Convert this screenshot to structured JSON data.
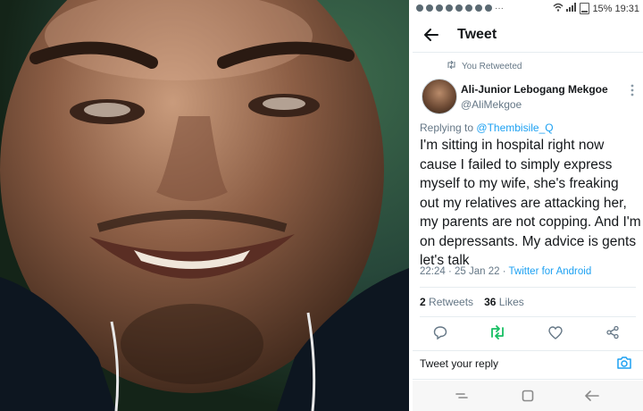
{
  "status_bar": {
    "battery_percent": "15%",
    "time": "19:31"
  },
  "header": {
    "title": "Tweet",
    "back_icon": "arrow-left-icon"
  },
  "tweet": {
    "retweeted_label": "You Retweeted",
    "display_name": "Ali-Junior Lebogang Mekgoe",
    "handle": "@AliMekgoe",
    "replying_prefix": "Replying to",
    "replying_to": "@Thembisile_Q",
    "text": "I'm sitting in hospital right now cause I failed to simply express myself to my wife, she's freaking out my relatives are attacking her, my parents are not copping. And I'm on depressants. My advice is gents let's talk",
    "timestamp": "22:24 · 25 Jan 22 · ",
    "client": "Twitter for Android",
    "retweets_count": "2",
    "retweets_label": "Retweets",
    "likes_count": "36",
    "likes_label": "Likes"
  },
  "reply": {
    "placeholder": "Tweet your reply"
  },
  "colors": {
    "accent": "#1da1f2",
    "retweet_active": "#17bf63",
    "muted": "#657786"
  }
}
